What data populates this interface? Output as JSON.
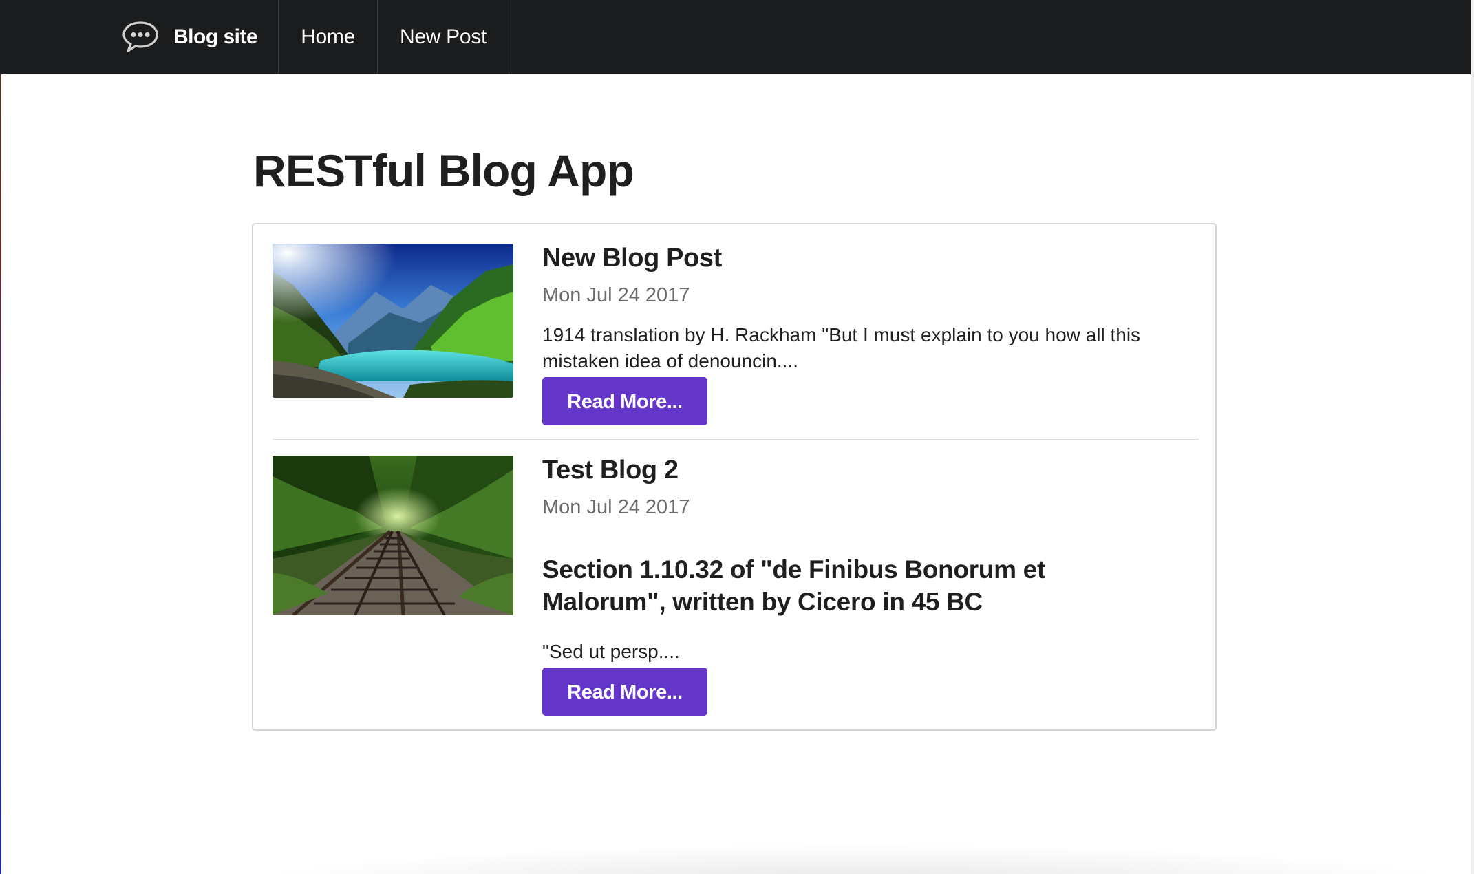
{
  "navbar": {
    "brand_icon": "chat-bubble-icon",
    "brand_label": "Blog site",
    "items": [
      {
        "label": "Home"
      },
      {
        "label": "New Post"
      }
    ],
    "background": "#1b1c1d"
  },
  "main": {
    "title": "RESTful Blog App"
  },
  "posts": [
    {
      "title": "New Blog Post",
      "date": "Mon Jul 24 2017",
      "excerpt": "1914 translation by H. Rackham \"But I must explain to you how all this mistaken idea of denouncin....",
      "image": "mountain-lake-landscape",
      "button_label": "Read More..."
    },
    {
      "title": "Test Blog 2",
      "date": "Mon Jul 24 2017",
      "heading": "Section 1.10.32 of \"de Finibus Bonorum et Malorum\", written by Cicero in 45 BC",
      "excerpt": "\"Sed ut persp....",
      "image": "railroad-tracks-forest",
      "button_label": "Read More..."
    }
  ],
  "colors": {
    "accent": "#6435c9",
    "text": "#1f1f1f",
    "meta": "#6b6b6b"
  }
}
